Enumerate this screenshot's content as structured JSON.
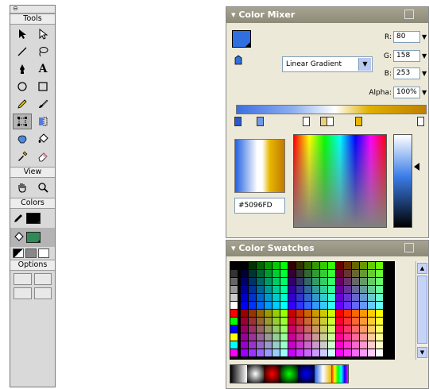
{
  "tools_panel": {
    "close_glyph": "⊖",
    "sections": {
      "tools": "Tools",
      "view": "View",
      "colors": "Colors",
      "options": "Options"
    },
    "tools": [
      {
        "icon": "arrow-icon"
      },
      {
        "icon": "subselect-icon"
      },
      {
        "icon": "line-icon"
      },
      {
        "icon": "lasso-icon"
      },
      {
        "icon": "pen-icon"
      },
      {
        "icon": "text-icon",
        "glyph": "A"
      },
      {
        "icon": "oval-icon"
      },
      {
        "icon": "rectangle-icon"
      },
      {
        "icon": "pencil-icon"
      },
      {
        "icon": "brush-icon"
      },
      {
        "icon": "free-transform-icon",
        "selected": true
      },
      {
        "icon": "fill-transform-icon"
      },
      {
        "icon": "ink-bottle-icon"
      },
      {
        "icon": "paint-bucket-icon"
      },
      {
        "icon": "eyedropper-icon"
      },
      {
        "icon": "eraser-icon"
      }
    ],
    "view_tools": [
      {
        "icon": "hand-icon"
      },
      {
        "icon": "zoom-icon"
      }
    ],
    "stroke_color": "#000000",
    "fill_color": "#2e8b57"
  },
  "color_mixer": {
    "title": "Color Mixer",
    "fill_type": "Linear Gradient",
    "r_label": "R:",
    "r_value": "80",
    "g_label": "G:",
    "g_value": "158",
    "b_label": "B:",
    "b_value": "253",
    "alpha_label": "Alpha:",
    "alpha_value": "100%",
    "hex_value": "#5096FD",
    "current_color": "#5096fd"
  },
  "color_swatches": {
    "title": "Color Swatches"
  }
}
